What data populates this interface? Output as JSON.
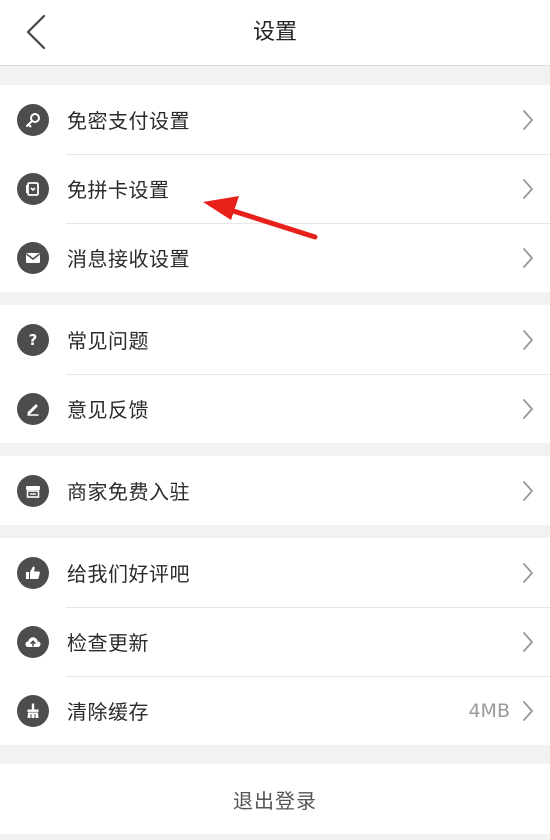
{
  "header": {
    "title": "设置"
  },
  "groups": [
    {
      "items": [
        {
          "label": "免密支付设置",
          "icon": "key-icon"
        },
        {
          "label": "免拼卡设置",
          "icon": "card-icon"
        },
        {
          "label": "消息接收设置",
          "icon": "mail-icon"
        }
      ]
    },
    {
      "items": [
        {
          "label": "常见问题",
          "icon": "question-icon"
        },
        {
          "label": "意见反馈",
          "icon": "pen-icon"
        }
      ]
    },
    {
      "items": [
        {
          "label": "商家免费入驻",
          "icon": "store-icon"
        }
      ]
    },
    {
      "items": [
        {
          "label": "给我们好评吧",
          "icon": "thumbs-up-icon"
        },
        {
          "label": "检查更新",
          "icon": "cloud-upload-icon"
        },
        {
          "label": "清除缓存",
          "icon": "broom-icon",
          "value": "4MB"
        }
      ]
    }
  ],
  "logout": {
    "label": "退出登录"
  },
  "colors": {
    "icon_bg": "#4d4d4d",
    "annotation_arrow": "#e8201a",
    "background": "#f2f2f2"
  }
}
